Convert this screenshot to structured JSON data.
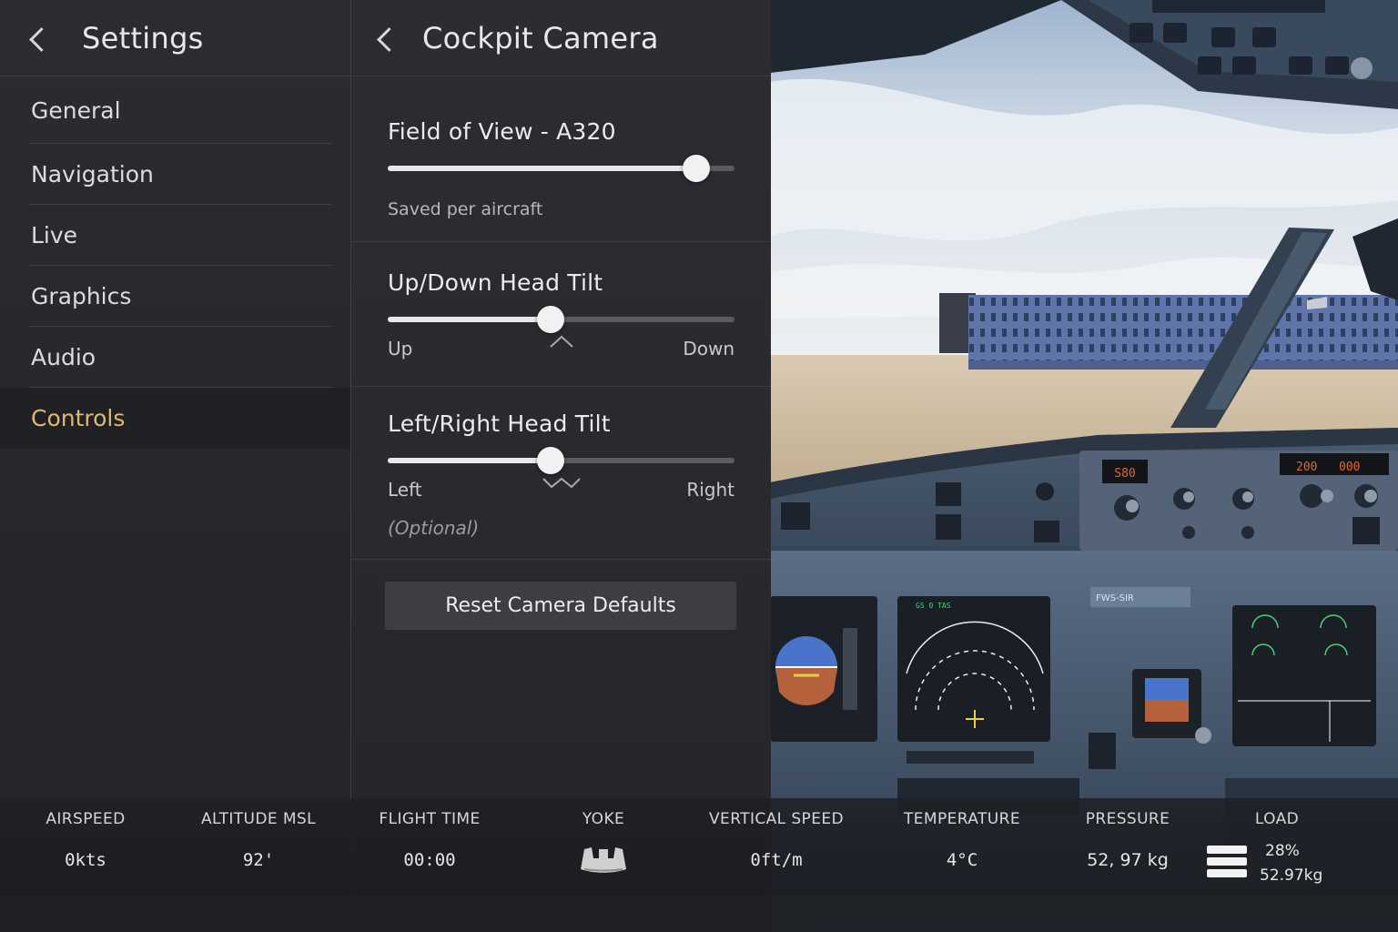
{
  "settings": {
    "title": "Settings",
    "menu": [
      {
        "label": "General"
      },
      {
        "label": "Navigation"
      },
      {
        "label": "Live"
      },
      {
        "label": "Graphics"
      },
      {
        "label": "Audio"
      },
      {
        "label": "Controls",
        "active": true
      }
    ]
  },
  "camera": {
    "title": "Cockpit Camera",
    "fov": {
      "label": "Field of View - A320",
      "value": 0.89,
      "note": "Saved per aircraft"
    },
    "updown": {
      "label": "Up/Down Head Tilt",
      "value": 0.47,
      "min_label": "Up",
      "max_label": "Down"
    },
    "leftright": {
      "label": "Left/Right Head Tilt",
      "value": 0.47,
      "min_label": "Left",
      "max_label": "Right",
      "note": "(Optional)"
    },
    "reset_label": "Reset Camera Defaults"
  },
  "status": {
    "airspeed": {
      "label": "AIRSPEED",
      "value": "0kts"
    },
    "altitude": {
      "label": "ALTITUDE MSL",
      "value": "92'"
    },
    "flight_time": {
      "label": "FLIGHT TIME",
      "value": "00:00"
    },
    "yoke": {
      "label": "YOKE",
      "icon": "yoke-icon"
    },
    "vertical_speed": {
      "label": "VERTICAL SPEED",
      "value": "0ft/m"
    },
    "temperature": {
      "label": "TEMPERATURE",
      "value": "4°C"
    },
    "pressure": {
      "label": "PRESSURE",
      "value": "52, 97 kg"
    },
    "load": {
      "label": "LOAD",
      "percent": "28%",
      "weight": "52.97kg",
      "icon": "menu-icon"
    }
  },
  "cockpit": {
    "fcu_speed": "S80",
    "fcu_hdg": "200",
    "fcu_alt": "000",
    "placard": "FWS-SIR"
  },
  "colors": {
    "accent": "#e3b869",
    "panel_bg": "#2a2c31",
    "cockpit_blue": "#4a5d74",
    "lcd_orange": "#e06a30",
    "ecam_green": "#47d27a"
  }
}
